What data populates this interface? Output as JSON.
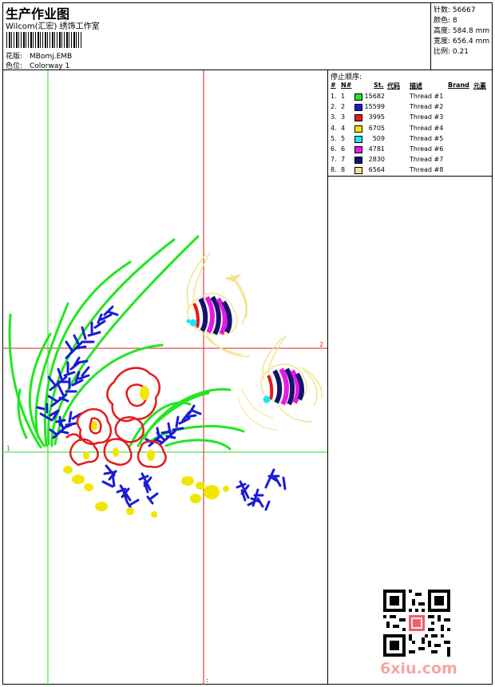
{
  "header": {
    "title": "生产作业图",
    "subtitle": "Wilcom(汇宏) 绣饰工作室",
    "design_label": "花版:",
    "design_value": "MBomj.EMB",
    "colorway_label": "色位:",
    "colorway_value": "Colorway 1"
  },
  "stats": {
    "stitches_label": "针数:",
    "stitches_value": "56667",
    "colors_label": "颜色:",
    "colors_value": "8",
    "height_label": "高度:",
    "height_value": "584.8 mm",
    "width_label": "宽度:",
    "width_value": "656.4 mm",
    "scale_label": "比例:",
    "scale_value": "0.21"
  },
  "sequence": {
    "title": "停止顺序:",
    "headers": {
      "hash": "#",
      "no": "N#",
      "st": "St.",
      "code": "代码",
      "desc": "描述",
      "brand": "Brand",
      "element": "元素"
    },
    "rows": [
      {
        "num": "1.",
        "n": "1",
        "color": "#22e622",
        "code": "15682",
        "desc": "Thread #1"
      },
      {
        "num": "2.",
        "n": "2",
        "color": "#1a1ad6",
        "code": "15599",
        "desc": "Thread #2"
      },
      {
        "num": "3.",
        "n": "3",
        "color": "#e61a1a",
        "code": "3995",
        "desc": "Thread #3"
      },
      {
        "num": "4.",
        "n": "4",
        "color": "#f2e600",
        "code": "6705",
        "desc": "Thread #4"
      },
      {
        "num": "5.",
        "n": "5",
        "color": "#1ae6f2",
        "code": "509",
        "desc": "Thread #5"
      },
      {
        "num": "6.",
        "n": "6",
        "color": "#e61ae6",
        "code": "4781",
        "desc": "Thread #6"
      },
      {
        "num": "7.",
        "n": "7",
        "color": "#14146e",
        "code": "2830",
        "desc": "Thread #7"
      },
      {
        "num": "8.",
        "n": "8",
        "color": "#f2e38a",
        "code": "6564",
        "desc": "Thread #8"
      }
    ]
  },
  "guides": {
    "left_marker": "1",
    "right_marker": "2",
    "bottom_marker": ":"
  },
  "watermark": "6xiu.com",
  "icons": {
    "qr": "qr-code-icon",
    "seal": "red-seal-icon"
  }
}
